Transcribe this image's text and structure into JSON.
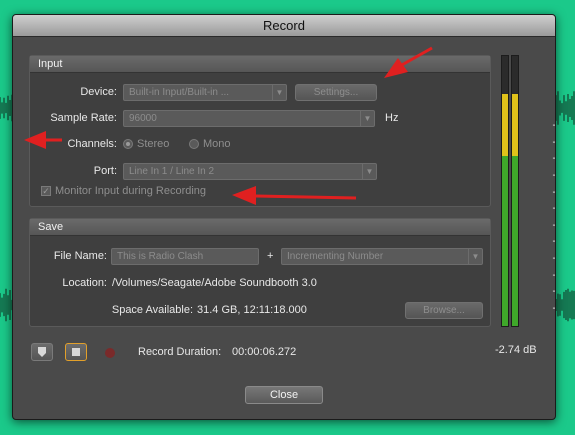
{
  "window": {
    "title": "Record"
  },
  "input": {
    "section_title": "Input",
    "device_label": "Device:",
    "device_value": "Built-in Input/Built-in ...",
    "settings_button": "Settings...",
    "sample_rate_label": "Sample Rate:",
    "sample_rate_value": "96000",
    "sample_rate_unit": "Hz",
    "channels_label": "Channels:",
    "channel_options": [
      "Stereo",
      "Mono"
    ],
    "channel_selected": "Stereo",
    "port_label": "Port:",
    "port_value": "Line In 1 / Line In 2",
    "monitor_label": "Monitor Input during Recording",
    "monitor_checked": true
  },
  "save": {
    "section_title": "Save",
    "file_name_label": "File Name:",
    "file_name_value": "This is Radio Clash",
    "plus": "+",
    "suffix_value": "Incrementing Number",
    "location_label": "Location:",
    "location_value": "/Volumes/Seagate/Adobe Soundbooth 3.0",
    "space_label": "Space Available:",
    "space_value": "31.4 GB, 12:11:18.000",
    "browse_button": "Browse..."
  },
  "meter": {
    "unit": "dB",
    "ticks": [
      "-6",
      "-9",
      "-12",
      "-15",
      "-18",
      "-21",
      "-24",
      "-27",
      "-30",
      "-33",
      "-36",
      "-39",
      "-42",
      "-45"
    ],
    "level_label": "-2.74 dB",
    "colors": {
      "green": "#3fa82a",
      "yellow": "#e0c21a",
      "red": "#c0392b"
    }
  },
  "transport": {
    "duration_label": "Record Duration:",
    "duration_value": "00:00:06.272",
    "record_active": true
  },
  "footer": {
    "close_button": "Close"
  },
  "colors": {
    "background": "#1bc98a",
    "annotation_arrow": "#e02020"
  }
}
